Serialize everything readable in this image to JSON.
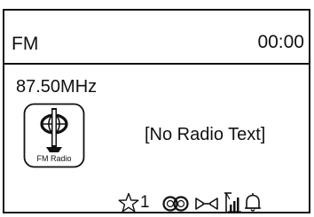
{
  "header": {
    "mode": "FM",
    "clock": "00:00"
  },
  "station": {
    "frequency": "87.50MHz",
    "radio_text": "[No Radio Text]",
    "logo_label": "FM Radio",
    "logo_icon": "fm-radio-antenna-icon"
  },
  "status": {
    "preset_icon": "star-icon",
    "preset_number": "1",
    "stereo_icon": "stereo-rings-icon",
    "speaker_icon": "speaker-icon",
    "signal_icon": "signal-strength-icon",
    "alarm_icon": "alarm-bell-icon"
  }
}
